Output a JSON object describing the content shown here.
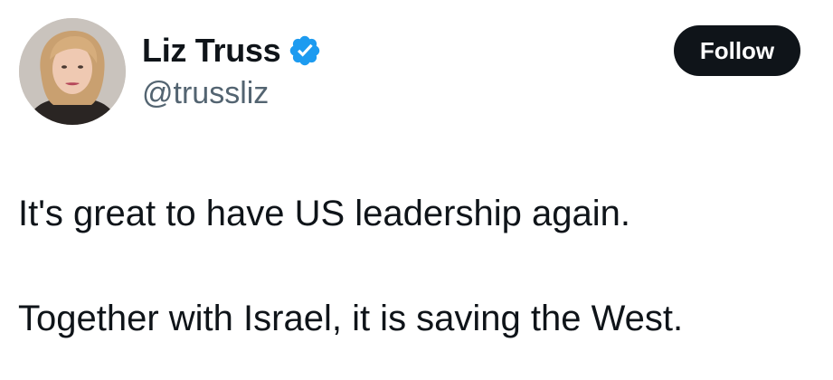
{
  "author": {
    "display_name": "Liz Truss",
    "handle": "@trussliz",
    "verified": true,
    "avatar_icon": "profile-photo",
    "verified_icon": "verified-badge-icon",
    "verified_color": "#1d9bf0"
  },
  "actions": {
    "follow_label": "Follow"
  },
  "tweet": {
    "paragraphs": [
      "It's great to have US leadership again.",
      "Together with Israel, it is saving the West."
    ]
  },
  "colors": {
    "text": "#0f1419",
    "secondary_text": "#536471",
    "button_bg": "#0f1419",
    "button_text": "#ffffff",
    "background": "#ffffff"
  }
}
